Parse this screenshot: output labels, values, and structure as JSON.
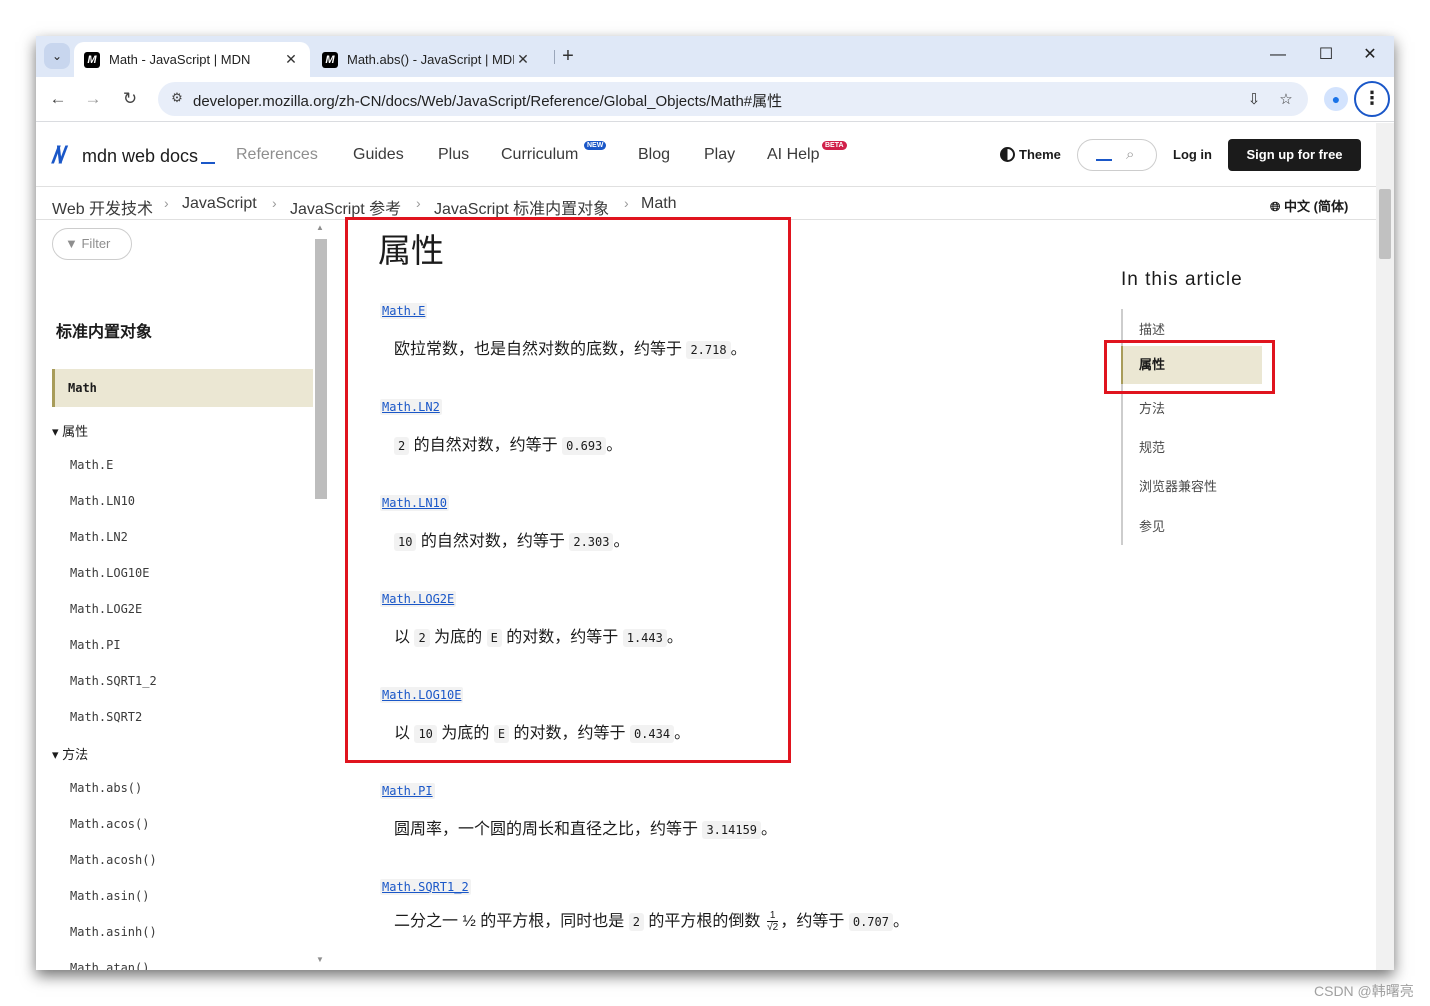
{
  "browser": {
    "tabs": [
      {
        "title": "Math - JavaScript | MDN",
        "active": true
      },
      {
        "title": "Math.abs() - JavaScript | MDN",
        "active": false
      }
    ],
    "url": "developer.mozilla.org/zh-CN/docs/Web/JavaScript/Reference/Global_Objects/Math#属性"
  },
  "header": {
    "logo": "mdn web docs",
    "nav": [
      {
        "label": "References"
      },
      {
        "label": "Guides"
      },
      {
        "label": "Plus"
      },
      {
        "label": "Curriculum",
        "badge": "NEW"
      },
      {
        "label": "Blog"
      },
      {
        "label": "Play"
      },
      {
        "label": "AI Help",
        "badge": "BETA"
      }
    ],
    "theme": "Theme",
    "login": "Log in",
    "signup": "Sign up for free"
  },
  "breadcrumbs": [
    "Web 开发技术",
    "JavaScript",
    "JavaScript 参考",
    "JavaScript 标准内置对象",
    "Math"
  ],
  "language": "中文 (简体)",
  "sidebar": {
    "filter_placeholder": "Filter",
    "heading": "标准内置对象",
    "current": "Math",
    "groups": [
      {
        "label": "属性",
        "items": [
          "Math.E",
          "Math.LN10",
          "Math.LN2",
          "Math.LOG10E",
          "Math.LOG2E",
          "Math.PI",
          "Math.SQRT1_2",
          "Math.SQRT2"
        ]
      },
      {
        "label": "方法",
        "items": [
          "Math.abs()",
          "Math.acos()",
          "Math.acosh()",
          "Math.asin()",
          "Math.asinh()",
          "Math.atan()"
        ]
      }
    ]
  },
  "article": {
    "heading": "属性",
    "entries": [
      {
        "term": "Math.E",
        "parts": [
          "欧拉常数，也是自然对数的底数，约等于 ",
          "2.718",
          "。"
        ]
      },
      {
        "term": "Math.LN2",
        "parts": [
          "2",
          " 的自然对数，约等于 ",
          "0.693",
          "。"
        ]
      },
      {
        "term": "Math.LN10",
        "parts": [
          "10",
          " 的自然对数，约等于 ",
          "2.303",
          "。"
        ]
      },
      {
        "term": "Math.LOG2E",
        "parts": [
          "以 ",
          "2",
          " 为底的 ",
          "E",
          " 的对数，约等于 ",
          "1.443",
          "。"
        ]
      },
      {
        "term": "Math.LOG10E",
        "parts": [
          "以 ",
          "10",
          " 为底的 ",
          "E",
          " 的对数，约等于 ",
          "0.434",
          "。"
        ]
      },
      {
        "term": "Math.PI",
        "parts": [
          "圆周率，一个圆的周长和直径之比，约等于 ",
          "3.14159",
          "。"
        ]
      },
      {
        "term": "Math.SQRT1_2",
        "parts": [
          "二分之一 ½ 的平方根，同时也是 ",
          "2",
          " 的平方根的倒数 ",
          "1",
          "√2",
          "，约等于 ",
          "0.707",
          "。"
        ]
      }
    ]
  },
  "toc": {
    "title": "In this article",
    "items": [
      "描述",
      "属性",
      "方法",
      "规范",
      "浏览器兼容性",
      "参见"
    ],
    "active": "属性"
  },
  "annotation_color": "#e0141e",
  "watermark": "CSDN @韩曙亮"
}
